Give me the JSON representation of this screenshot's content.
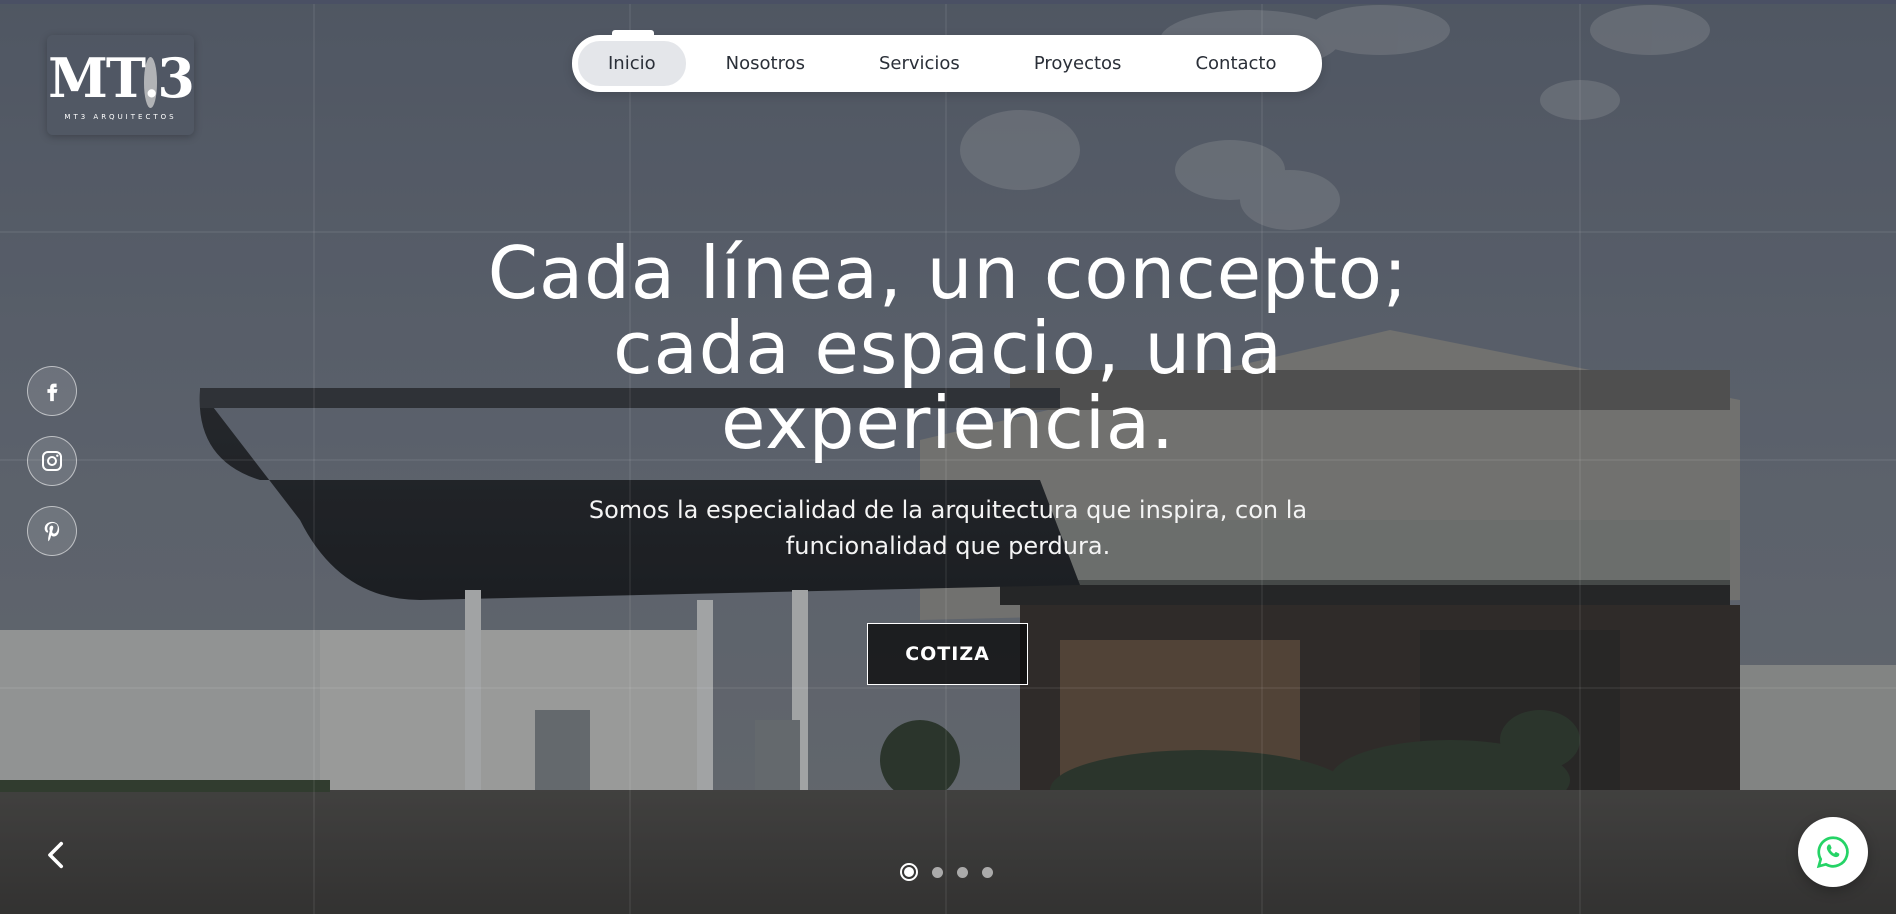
{
  "logo": {
    "mark": "MT",
    "mark_num": "3",
    "subtitle": "MT3 ARQUITECTOS"
  },
  "nav": {
    "items": [
      {
        "label": "Inicio",
        "active": true
      },
      {
        "label": "Nosotros"
      },
      {
        "label": "Servicios"
      },
      {
        "label": "Proyectos"
      },
      {
        "label": "Contacto"
      }
    ]
  },
  "social": [
    {
      "icon": "facebook-icon"
    },
    {
      "icon": "instagram-icon"
    },
    {
      "icon": "pinterest-icon"
    }
  ],
  "hero": {
    "title_line1": "Cada línea, un concepto;",
    "title_line2": "cada espacio, una",
    "title_line3": "experiencia.",
    "subtitle_line1": "Somos la especialidad de la arquitectura que inspira, con la",
    "subtitle_line2": "funcionalidad que perdura.",
    "cta_label": "COTIZA"
  },
  "slider": {
    "total": 4,
    "active": 1,
    "prev_icon": "chevron-left-icon"
  },
  "whatsapp": {
    "icon": "whatsapp-icon",
    "color": "#25d366"
  },
  "colors": {
    "nav_active_bg": "#e4e6ea",
    "text_dark": "#2a2f38",
    "white": "#ffffff"
  }
}
